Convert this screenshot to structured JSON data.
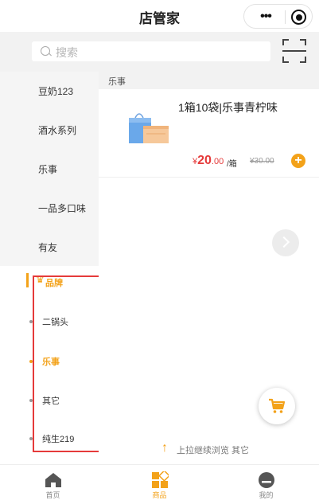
{
  "header": {
    "title": "店管家",
    "more_label": "•••"
  },
  "search": {
    "placeholder": "搜索"
  },
  "sidebar": {
    "categories": [
      {
        "label": "豆奶123"
      },
      {
        "label": "酒水系列"
      },
      {
        "label": "乐事"
      },
      {
        "label": "一品多口味"
      },
      {
        "label": "有友"
      }
    ],
    "brand": {
      "label": "品牌",
      "items": [
        {
          "label": "二锅头",
          "active": false
        },
        {
          "label": "乐事",
          "active": true
        },
        {
          "label": "其它",
          "active": false
        },
        {
          "label": "纯生219",
          "active": false
        }
      ]
    }
  },
  "content": {
    "section_title": "乐事",
    "product": {
      "name": "1箱10袋|乐事青柠味",
      "price_symbol": "¥",
      "price_main": "20",
      "price_decimal": ".00",
      "unit": "/箱",
      "old_price": "¥30.00",
      "add_label": "+"
    },
    "pullup_text": "上拉继续浏览 其它"
  },
  "tabbar": {
    "tabs": [
      {
        "label": "首页",
        "active": false
      },
      {
        "label": "商品",
        "active": true
      },
      {
        "label": "我的",
        "active": false
      }
    ]
  },
  "colors": {
    "accent": "#f3a21a",
    "price": "#e53a3a",
    "highlight_frame": "#e53a3a"
  }
}
